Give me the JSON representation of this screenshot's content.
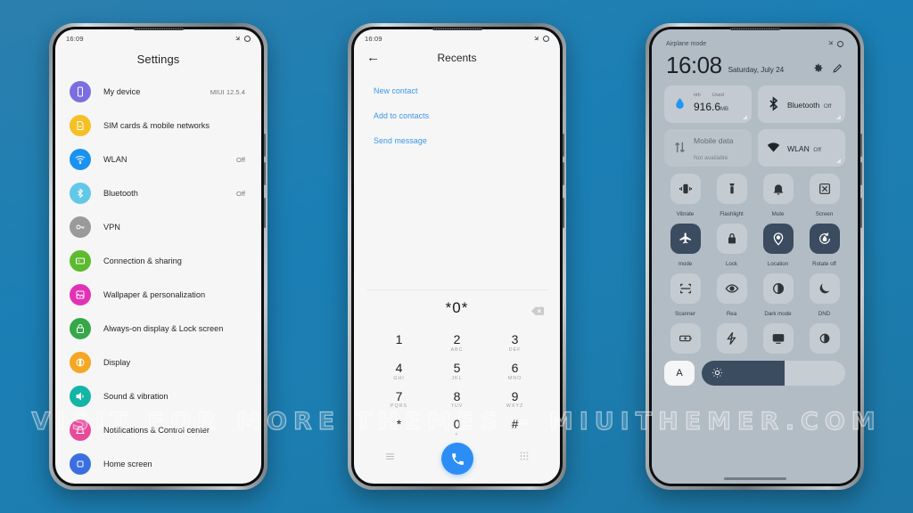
{
  "watermark": "VISIT FOR MORE THEMES - MIUITHEMER.COM",
  "phone1": {
    "status": {
      "time": "16:09",
      "airplane_icon": "airplane-icon",
      "ring_icon": "circle-icon"
    },
    "title": "Settings",
    "items": [
      {
        "label": "My device",
        "value": "MIUI 12.5.4",
        "icon": "phone-icon",
        "color": "#7b6fe0"
      },
      {
        "label": "SIM cards & mobile networks",
        "value": "",
        "icon": "sim-card-icon",
        "color": "#f5c024"
      },
      {
        "label": "WLAN",
        "value": "Off",
        "icon": "wifi-icon",
        "color": "#1a92f0"
      },
      {
        "label": "Bluetooth",
        "value": "Off",
        "icon": "bluetooth-icon",
        "color": "#63c8e8"
      },
      {
        "label": "VPN",
        "value": "",
        "icon": "key-icon",
        "color": "#9a9a9a"
      },
      {
        "label": "Connection & sharing",
        "value": "",
        "icon": "share-icon",
        "color": "#5cba2e"
      },
      {
        "label": "Wallpaper & personalization",
        "value": "",
        "icon": "wallpaper-icon",
        "color": "#e331b5"
      },
      {
        "label": "Always-on display & Lock screen",
        "value": "",
        "icon": "lock-icon",
        "color": "#37a84a"
      },
      {
        "label": "Display",
        "value": "",
        "icon": "brightness-icon",
        "color": "#f5a623"
      },
      {
        "label": "Sound & vibration",
        "value": "",
        "icon": "speaker-icon",
        "color": "#12b5a6"
      },
      {
        "label": "Notifications & Control center",
        "value": "",
        "icon": "bell-icon",
        "color": "#e8499b"
      },
      {
        "label": "Home screen",
        "value": "",
        "icon": "square-icon",
        "color": "#3b6fe0"
      }
    ]
  },
  "phone2": {
    "status": {
      "time": "16:09",
      "airplane_icon": "airplane-icon",
      "ring_icon": "circle-icon"
    },
    "header": {
      "back_icon": "back-arrow-icon",
      "title": "Recents"
    },
    "actions": [
      {
        "label": "New contact"
      },
      {
        "label": "Add to contacts"
      },
      {
        "label": "Send message"
      }
    ],
    "dialed_number": "*0*",
    "backspace_icon": "backspace-icon",
    "keys": [
      {
        "digit": "1",
        "letters": ""
      },
      {
        "digit": "2",
        "letters": "ABC"
      },
      {
        "digit": "3",
        "letters": "DEF"
      },
      {
        "digit": "4",
        "letters": "GHI"
      },
      {
        "digit": "5",
        "letters": "JKL"
      },
      {
        "digit": "6",
        "letters": "MNO"
      },
      {
        "digit": "7",
        "letters": "PQRS"
      },
      {
        "digit": "8",
        "letters": "TUV"
      },
      {
        "digit": "9",
        "letters": "WXYZ"
      },
      {
        "digit": "*",
        "letters": ""
      },
      {
        "digit": "0",
        "letters": "+"
      },
      {
        "digit": "#",
        "letters": ""
      }
    ],
    "bottom": {
      "menu_icon": "menu-icon",
      "call_icon": "phone-call-icon",
      "keypad_icon": "keypad-icon"
    },
    "accent": "#2c8ef5"
  },
  "phone3": {
    "status": {
      "label": "Airplane mode",
      "airplane_icon": "airplane-icon",
      "ring_icon": "circle-icon"
    },
    "clock": {
      "time": "16:08",
      "date": "Saturday, July 24"
    },
    "header_icons": [
      {
        "name": "gear-icon"
      },
      {
        "name": "edit-pencil-icon"
      }
    ],
    "big_tiles": [
      {
        "icon": "data-drop-icon",
        "type": "data",
        "label_left": "nth",
        "label_right": "Used",
        "value": "916.6",
        "unit": "MB",
        "dim": false
      },
      {
        "icon": "bluetooth-icon",
        "type": "text",
        "title": "Bluetooth",
        "subtitle": "Off",
        "dim": false
      },
      {
        "icon": "mobile-data-icon",
        "type": "text",
        "title": "Mobile data",
        "subtitle": "Not available",
        "dim": true
      },
      {
        "icon": "wifi-icon",
        "type": "text",
        "title": "WLAN",
        "subtitle": "Off",
        "dim": false
      }
    ],
    "toggles": [
      {
        "label": "Vibrate",
        "icon": "vibrate-icon",
        "on": false
      },
      {
        "label": "Flashlight",
        "icon": "flashlight-icon",
        "on": false
      },
      {
        "label": "Mute",
        "icon": "bell-mute-icon",
        "on": false
      },
      {
        "label": "Screen",
        "icon": "screenshot-icon",
        "on": false
      },
      {
        "label": "mode",
        "icon": "airplane-icon",
        "on": true
      },
      {
        "label": "Lock",
        "icon": "padlock-icon",
        "on": false
      },
      {
        "label": "Location",
        "icon": "location-pin-icon",
        "on": true
      },
      {
        "label": "Rotate off",
        "icon": "rotate-lock-icon",
        "on": true
      },
      {
        "label": "Scanner",
        "icon": "scanner-icon",
        "on": false
      },
      {
        "label": "Rea",
        "icon": "eye-icon",
        "on": false
      },
      {
        "label": "Dark mode",
        "icon": "contrast-icon",
        "on": false
      },
      {
        "label": "DND",
        "icon": "moon-icon",
        "on": false
      },
      {
        "label": "",
        "icon": "battery-icon",
        "on": false
      },
      {
        "label": "",
        "icon": "lightning-icon",
        "on": false
      },
      {
        "label": "",
        "icon": "cast-icon",
        "on": false
      },
      {
        "label": "",
        "icon": "half-circle-icon",
        "on": false
      }
    ],
    "brightness": {
      "auto_label": "A",
      "sun_icon": "brightness-sun-icon",
      "level_percent": 58
    },
    "accent": "#3b4b60"
  }
}
